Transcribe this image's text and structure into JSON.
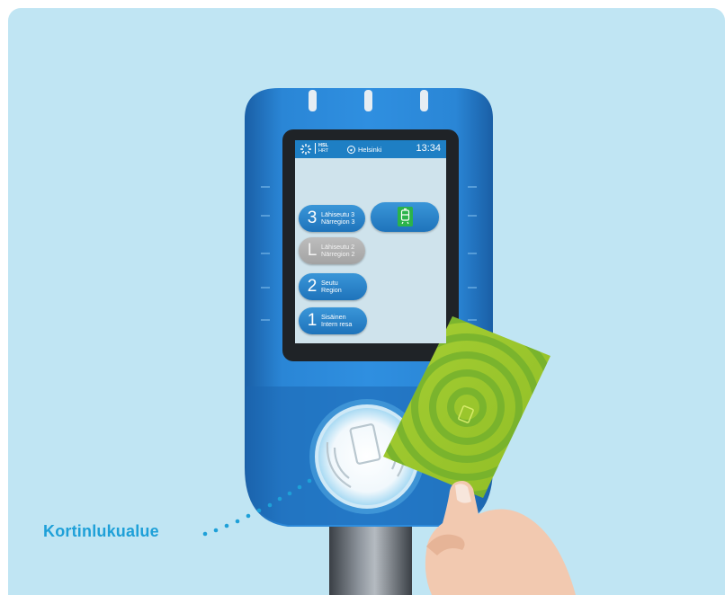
{
  "screen": {
    "brand": {
      "name": "HSL",
      "sub": "HRT"
    },
    "location": "Helsinki",
    "time": "13:34",
    "zones": [
      {
        "letter": "3",
        "line1": "Lähiseutu 3",
        "line2": "Närregion 3",
        "enabled": true
      },
      {
        "letter": "L",
        "line1": "Lähiseutu 2",
        "line2": "Närregion 2",
        "enabled": false
      },
      {
        "letter": "2",
        "line1": "Seutu",
        "line2": "Region",
        "enabled": true
      },
      {
        "letter": "1",
        "line1": "Sisäinen",
        "line2": "Intern resa",
        "enabled": true
      }
    ],
    "mode_icon": "tram-icon"
  },
  "caption": "Kortinlukualue",
  "colors": {
    "background": "#c0e5f3",
    "device_blue": "#1d72c0",
    "accent_cyan": "#1ea0d8",
    "card_green": "#9dc92c",
    "tram_green": "#2bb34a"
  }
}
